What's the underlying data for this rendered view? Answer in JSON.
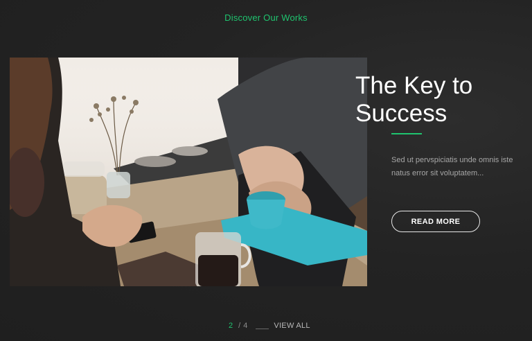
{
  "header": {
    "eyebrow": "Discover Our Works"
  },
  "slide": {
    "image_alt": "Two people shaking hands over a cafe table",
    "title": "The Key to Success",
    "description": "Sed ut pervspiciatis unde omnis iste natus error sit voluptatem...",
    "cta_label": "READ MORE"
  },
  "pager": {
    "current": "2",
    "separator": "/",
    "total": "4",
    "view_all_label": "VIEW ALL"
  },
  "colors": {
    "accent": "#1fc46f",
    "background": "#232323",
    "text_muted": "#a7a7a7"
  }
}
